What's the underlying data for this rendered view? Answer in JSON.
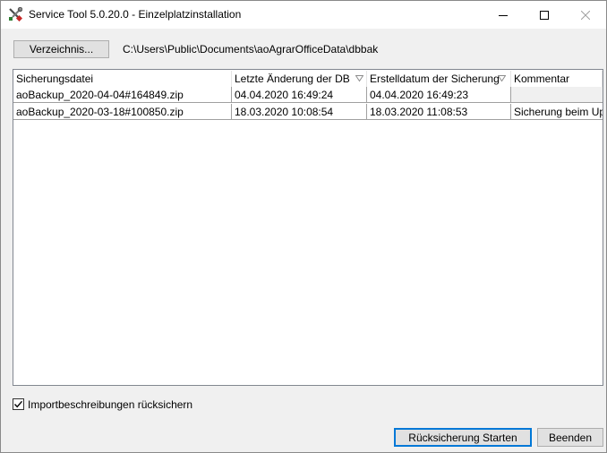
{
  "window": {
    "title": "Service Tool 5.0.20.0 - Einzelplatzinstallation",
    "icon": "wrench-screwdriver-icon"
  },
  "toolbar": {
    "directory_button": "Verzeichnis...",
    "directory_path": "C:\\Users\\Public\\Documents\\aoAgrarOfficeData\\dbbak"
  },
  "table": {
    "columns": [
      "Sicherungsdatei",
      "Letzte Änderung der DB",
      "Erstelldatum der Sicherung",
      "Kommentar"
    ],
    "rows": [
      [
        "aoBackup_2020-04-04#164849.zip",
        "04.04.2020 16:49:24",
        "04.04.2020 16:49:23",
        ""
      ],
      [
        "aoBackup_2020-03-18#100850.zip",
        "18.03.2020 10:08:54",
        "18.03.2020 11:08:53",
        "Sicherung beim Upda"
      ]
    ]
  },
  "options": {
    "import_checkbox_label": "Importbeschreibungen rücksichern",
    "import_checked": true
  },
  "actions": {
    "restore_label": "Rücksicherung Starten",
    "quit_label": "Beenden"
  }
}
